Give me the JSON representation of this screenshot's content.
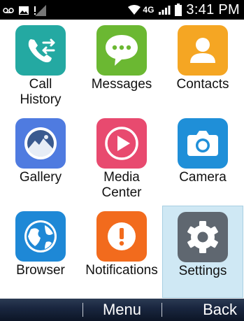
{
  "status_bar": {
    "network": "4G",
    "time": "3:41 PM"
  },
  "apps": [
    {
      "label": "Call\nHistory",
      "icon": "call-history-icon",
      "color": "#24a9a2"
    },
    {
      "label": "Messages",
      "icon": "messages-icon",
      "color": "#6bb832"
    },
    {
      "label": "Contacts",
      "icon": "contacts-icon",
      "color": "#f5a623"
    },
    {
      "label": "Gallery",
      "icon": "gallery-icon",
      "color": "#4f7be0"
    },
    {
      "label": "Media\nCenter",
      "icon": "media-center-icon",
      "color": "#e84a6f"
    },
    {
      "label": "Camera",
      "icon": "camera-icon",
      "color": "#1f8fd8"
    },
    {
      "label": "Browser",
      "icon": "browser-icon",
      "color": "#1e88d6"
    },
    {
      "label": "Notifications",
      "icon": "notifications-icon",
      "color": "#f26b1d"
    },
    {
      "label": "Settings",
      "icon": "settings-icon",
      "color": "#5f6770",
      "selected": true
    }
  ],
  "softkeys": {
    "center": "Menu",
    "right": "Back"
  }
}
